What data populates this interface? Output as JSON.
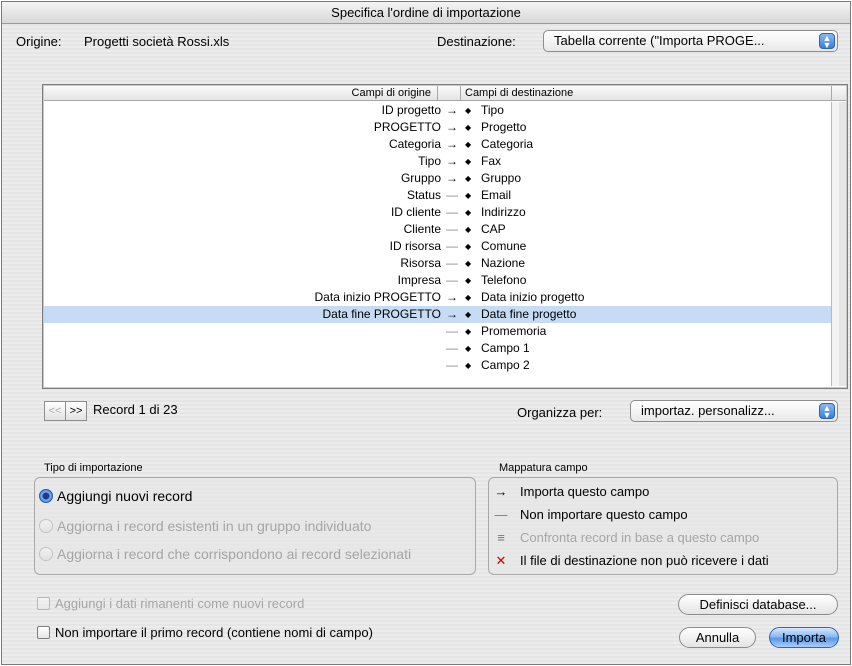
{
  "window": {
    "title": "Specifica l'ordine di importazione"
  },
  "source": {
    "label": "Origine:",
    "file": "Progetti società Rossi.xls"
  },
  "destination": {
    "label": "Destinazione:",
    "value": "Tabella corrente (\"Importa PROGE..."
  },
  "list": {
    "headers": {
      "source": "Campi di origine",
      "destination": "Campi di destinazione"
    },
    "rows": [
      {
        "source": "ID progetto",
        "mapping": "→",
        "destination": "Tipo"
      },
      {
        "source": "PROGETTO",
        "mapping": "→",
        "destination": "Progetto"
      },
      {
        "source": "Categoria",
        "mapping": "→",
        "destination": "Categoria"
      },
      {
        "source": "Tipo",
        "mapping": "→",
        "destination": "Fax"
      },
      {
        "source": "Gruppo",
        "mapping": "→",
        "destination": "Gruppo"
      },
      {
        "source": "Status",
        "mapping": "—",
        "destination": "Email"
      },
      {
        "source": "ID cliente",
        "mapping": "—",
        "destination": "Indirizzo"
      },
      {
        "source": "Cliente",
        "mapping": "—",
        "destination": "CAP"
      },
      {
        "source": "ID risorsa",
        "mapping": "—",
        "destination": "Comune"
      },
      {
        "source": "Risorsa",
        "mapping": "—",
        "destination": "Nazione"
      },
      {
        "source": "Impresa",
        "mapping": "—",
        "destination": "Telefono"
      },
      {
        "source": "Data inizio PROGETTO",
        "mapping": "→",
        "destination": "Data inizio progetto"
      },
      {
        "source": "Data fine PROGETTO",
        "mapping": "→",
        "destination": "Data fine progetto",
        "selected": true
      },
      {
        "source": "",
        "mapping": "—",
        "destination": "Promemoria"
      },
      {
        "source": "",
        "mapping": "—",
        "destination": "Campo 1"
      },
      {
        "source": "",
        "mapping": "—",
        "destination": "Campo 2"
      }
    ]
  },
  "navigation": {
    "prev": "<<",
    "next": ">>",
    "record_text": "Record 1 di 23"
  },
  "sort": {
    "label": "Organizza per:",
    "value": "importaz. personalizz..."
  },
  "import_type": {
    "title": "Tipo di importazione",
    "options": [
      {
        "label": "Aggiungi nuovi record",
        "selected": true,
        "enabled": true
      },
      {
        "label": "Aggiorna i record esistenti in un gruppo individuato",
        "selected": false,
        "enabled": false
      },
      {
        "label": "Aggiorna i record che corrispondono ai record selezionati",
        "selected": false,
        "enabled": false
      }
    ]
  },
  "field_mapping": {
    "title": "Mappatura campo",
    "items": [
      {
        "symbol": "→",
        "label": "Importa questo campo",
        "enabled": true
      },
      {
        "symbol": "—",
        "label": "Non importare questo campo",
        "enabled": true
      },
      {
        "symbol": "≡",
        "label": "Confronta record in base a questo campo",
        "enabled": false
      },
      {
        "symbol": "✕",
        "label": "Il file di destinazione non può ricevere i dati",
        "enabled": true
      }
    ]
  },
  "checkboxes": {
    "append_remaining": "Aggiungi i dati rimanenti come nuovi record",
    "skip_first": "Non importare il primo record (contiene nomi di campo)"
  },
  "buttons": {
    "define_database": "Definisci database...",
    "cancel": "Annulla",
    "import": "Importa"
  },
  "colors": {
    "selection": "#c6dcf5",
    "accent": "#3b7ad6",
    "error": "#d40000"
  }
}
